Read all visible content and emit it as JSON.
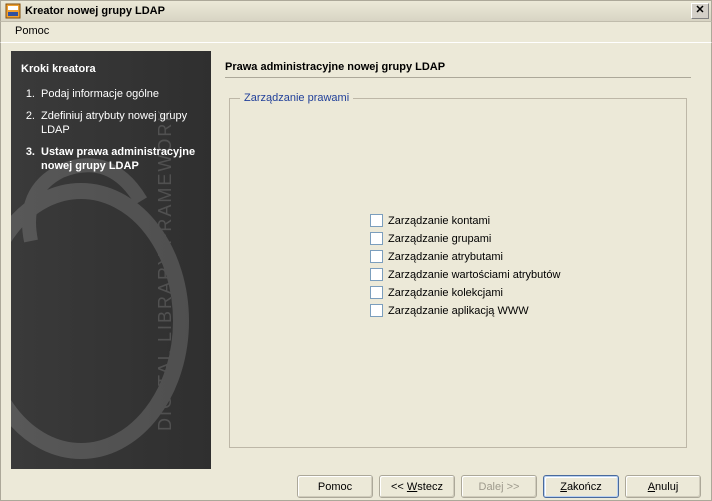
{
  "window": {
    "title": "Kreator nowej grupy LDAP"
  },
  "menubar": {
    "help": "Pomoc"
  },
  "sidebar": {
    "heading": "Kroki kreatora",
    "steps": [
      {
        "num": "1.",
        "label": "Podaj informacje ogólne"
      },
      {
        "num": "2.",
        "label": "Zdefiniuj atrybuty nowej grupy LDAP"
      },
      {
        "num": "3.",
        "label": "Ustaw prawa administracyjne nowej grupy LDAP"
      }
    ]
  },
  "content": {
    "title": "Prawa administracyjne nowej grupy LDAP",
    "groupbox_title": "Zarządzanie prawami",
    "options": [
      "Zarządzanie kontami",
      "Zarządzanie grupami",
      "Zarządzanie atrybutami",
      "Zarządzanie wartościami atrybutów",
      "Zarządzanie kolekcjami",
      "Zarządzanie aplikacją WWW"
    ]
  },
  "buttons": {
    "help": "Pomoc",
    "back_prefix": "<< ",
    "back_letter": "W",
    "back_rest": "stecz",
    "next_prefix": "Dale",
    "next_letter": "j",
    "next_suffix": " >>",
    "finish_letter": "Z",
    "finish_rest": "akończ",
    "cancel_letter": "A",
    "cancel_rest": "nuluj"
  }
}
